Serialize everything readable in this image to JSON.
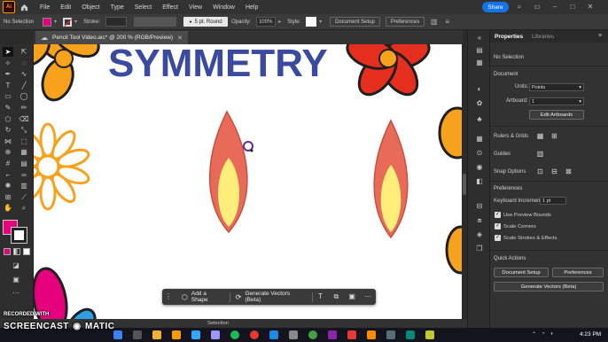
{
  "menubar": {
    "logo": "Ai",
    "items": [
      "File",
      "Edit",
      "Object",
      "Type",
      "Select",
      "Effect",
      "View",
      "Window",
      "Help"
    ],
    "share_label": "Share"
  },
  "controlbar": {
    "selection_label": "No Selection",
    "stroke_label": "Stroke:",
    "brush_label": "5 pt. Round",
    "opacity_label": "Opacity:",
    "opacity_value": "100%",
    "style_label": "Style:",
    "document_setup_label": "Document Setup",
    "preferences_label": "Preferences",
    "fill_color": "#e6007e"
  },
  "document": {
    "tab_title": "Pencil Tool Video.aic* @ 200 % (RGB/Preview)"
  },
  "canvas": {
    "title_text": "SYMMETRY",
    "title_color": "#3a4a9f"
  },
  "context_bar": {
    "add_shape_label": "Add a Shape",
    "generate_label": "Generate Vectors (Beta)"
  },
  "properties": {
    "tabs": [
      "Properties",
      "Libraries"
    ],
    "no_selection": "No Selection",
    "document_head": "Document",
    "units_label": "Units:",
    "units_value": "Points",
    "artboard_label": "Artboard:",
    "artboard_value": "1",
    "edit_artboards_label": "Edit Artboards",
    "rulers_label": "Rulers & Grids",
    "guides_label": "Guides",
    "snap_label": "Snap Options",
    "preferences_head": "Preferences",
    "keyboard_label": "Keyboard Increment:",
    "keyboard_value": "1 pt",
    "checks": [
      "Use Preview Bounds",
      "Scale Corners",
      "Scale Strokes & Effects"
    ],
    "quick_actions_head": "Quick Actions",
    "document_setup_label": "Document Setup",
    "preferences_label": "Preferences",
    "generate_label": "Generate Vectors (Beta)"
  },
  "statusbar": {
    "tool_text": "Selection"
  },
  "taskbar": {
    "clock": "4:23 PM"
  },
  "watermark": {
    "top": "RECORDED WITH",
    "bottom": "SCREENCAST",
    "bottom_suffix": "MATIC"
  }
}
